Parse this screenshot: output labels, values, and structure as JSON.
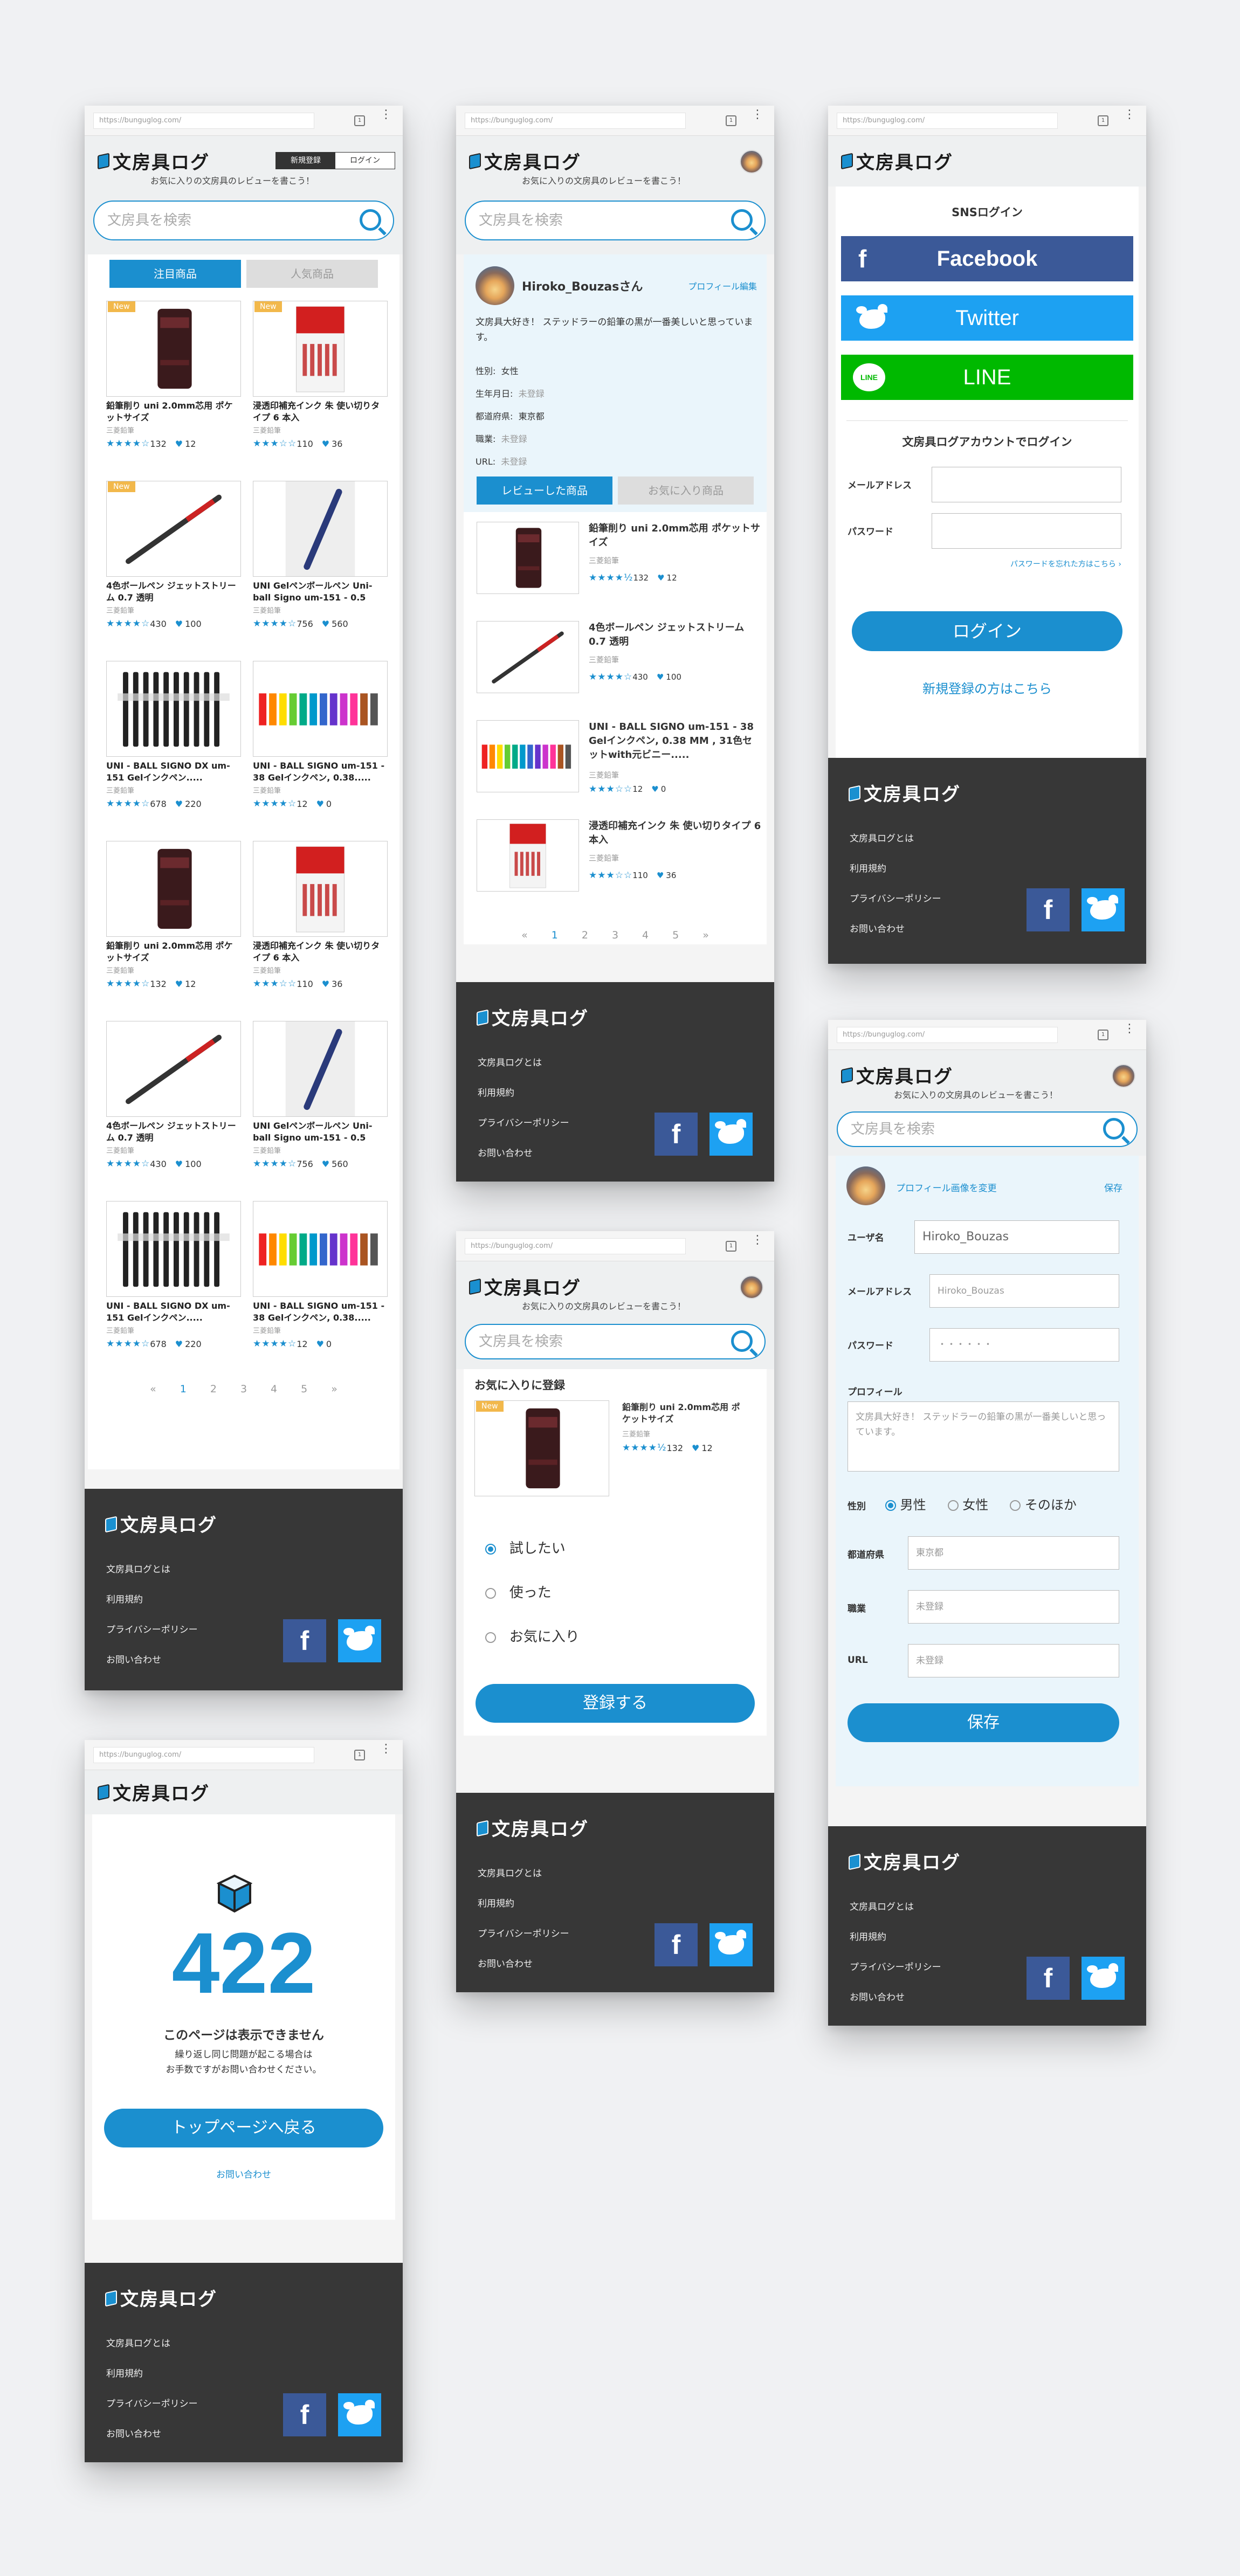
{
  "url": "https://bunguglog.com/",
  "brand": {
    "logo_text": "文房具ログ",
    "tagline": "お気に入りの文房具のレビューを書こう！"
  },
  "auth": {
    "signup": "新規登録",
    "login": "ログイン"
  },
  "search": {
    "placeholder": "文房具を検索"
  },
  "tabs": {
    "featured": "注目商品",
    "popular": "人気商品"
  },
  "new_tag": "New",
  "products": [
    {
      "title": "鉛筆削り uni 2.0mm芯用 ポケットサイズ",
      "maker": "三菱鉛筆",
      "rating": "★★★★☆",
      "reviews": "132",
      "likes": "12"
    },
    {
      "title": "浸透印補充インク 朱 使い切りタイプ 6 本入",
      "maker": "三菱鉛筆",
      "rating": "★★★☆☆",
      "reviews": "110",
      "likes": "36"
    },
    {
      "title": "4色ボールペン ジェットストリーム 0.7 透明",
      "maker": "三菱鉛筆",
      "rating": "★★★★☆",
      "reviews": "430",
      "likes": "100"
    },
    {
      "title": "UNI Gelペンボールペン Uni-ball Signo um-151 - 0.5",
      "maker": "三菱鉛筆",
      "rating": "★★★★☆",
      "reviews": "756",
      "likes": "560"
    },
    {
      "title": "UNI - BALL SIGNO DX um-151 Gelインクペン.....",
      "maker": "三菱鉛筆",
      "rating": "★★★★☆",
      "reviews": "678",
      "likes": "220"
    },
    {
      "title": "UNI - BALL SIGNO um-151 - 38 Gelインクペン, 0.38.....",
      "maker": "三菱鉛筆",
      "rating": "★★★★☆",
      "reviews": "12",
      "likes": "0"
    }
  ],
  "pagination": [
    "«",
    "1",
    "2",
    "3",
    "4",
    "5",
    "»"
  ],
  "footer": {
    "links": [
      "文房具ログとは",
      "利用規約",
      "プライバシーポリシー",
      "お問い合わせ"
    ],
    "facebook": "f"
  },
  "profile": {
    "name": "Hiroko_Bouzasさん",
    "edit": "プロフィール編集",
    "bio": "文房具大好き！ ステッドラーの鉛筆の黒が一番美しいと思っています。",
    "rows": [
      {
        "label": "性別:",
        "value": "女性"
      },
      {
        "label": "生年月日:",
        "value": "未登録"
      },
      {
        "label": "都道府県:",
        "value": "東京都"
      },
      {
        "label": "職業:",
        "value": "未登録"
      },
      {
        "label": "URL:",
        "value": "未登録"
      }
    ],
    "tab_reviewed": "レビューした商品",
    "tab_fav": "お気に入り商品",
    "list": [
      {
        "title": "鉛筆削り uni 2.0mm芯用 ポケットサイズ",
        "maker": "三菱鉛筆",
        "rating": "★★★★½",
        "reviews": "132",
        "likes": "12"
      },
      {
        "title": "4色ボールペン ジェットストリーム 0.7 透明",
        "maker": "三菱鉛筆",
        "rating": "★★★★☆",
        "reviews": "430",
        "likes": "100"
      },
      {
        "title": "UNI - BALL SIGNO um-151 - 38 Gelインクペン, 0.38 MM , 31色セットwith元ビニー.....",
        "maker": "三菱鉛筆",
        "rating": "★★★☆☆",
        "reviews": "12",
        "likes": "0"
      },
      {
        "title": "浸透印補充インク 朱 使い切りタイプ 6 本入",
        "maker": "三菱鉛筆",
        "rating": "★★★☆☆",
        "reviews": "110",
        "likes": "36"
      }
    ]
  },
  "login": {
    "sns_title": "SNSログイン",
    "facebook": "Facebook",
    "twitter": "Twitter",
    "line": "LINE",
    "line_icon": "LINE",
    "account_title": "文房具ログアカウントでログイン",
    "email": "メールアドレス",
    "password": "パスワード",
    "forgot": "パスワードを忘れた方はこちら ›",
    "submit": "ログイン",
    "register": "新規登録の方はこちら"
  },
  "favorite": {
    "title": "お気に入りに登録",
    "product": {
      "title": "鉛筆削り uni 2.0mm芯用 ポケットサイズ",
      "maker": "三菱鉛筆",
      "rating": "★★★★½",
      "reviews": "132",
      "likes": "12"
    },
    "options": [
      "試したい",
      "使った",
      "お気に入り"
    ],
    "submit": "登録する"
  },
  "edit": {
    "change_image": "プロフィール画像を変更",
    "save_link": "保存",
    "username_label": "ユーザ名",
    "username_value": "Hiroko_Bouzas",
    "email_label": "メールアドレス",
    "email_value": "Hiroko_Bouzas",
    "password_label": "パスワード",
    "password_value": "・・・・・・",
    "profile_label": "プロフィール",
    "profile_value": "文房具大好き！ ステッドラーの鉛筆の黒が一番美しいと思っています。",
    "gender_label": "性別",
    "genders": [
      "男性",
      "女性",
      "そのほか"
    ],
    "pref_label": "都道府県",
    "pref_value": "東京都",
    "job_label": "職業",
    "job_value": "未登録",
    "url_label": "URL",
    "url_value": "未登録",
    "save_button": "保存"
  },
  "error": {
    "code": "422",
    "title": "このページは表示できません",
    "message1": "繰り返し同じ問題が起こる場合は",
    "message2": "お手数ですがお問い合わせください。",
    "back": "トップページへ戻る",
    "contact": "お問い合わせ"
  },
  "colors": {
    "accent": "#1b8fcf",
    "footer": "#373737",
    "facebook": "#3b5998",
    "twitter": "#1da1f2",
    "line": "#00b900",
    "new": "#f2b84b"
  }
}
